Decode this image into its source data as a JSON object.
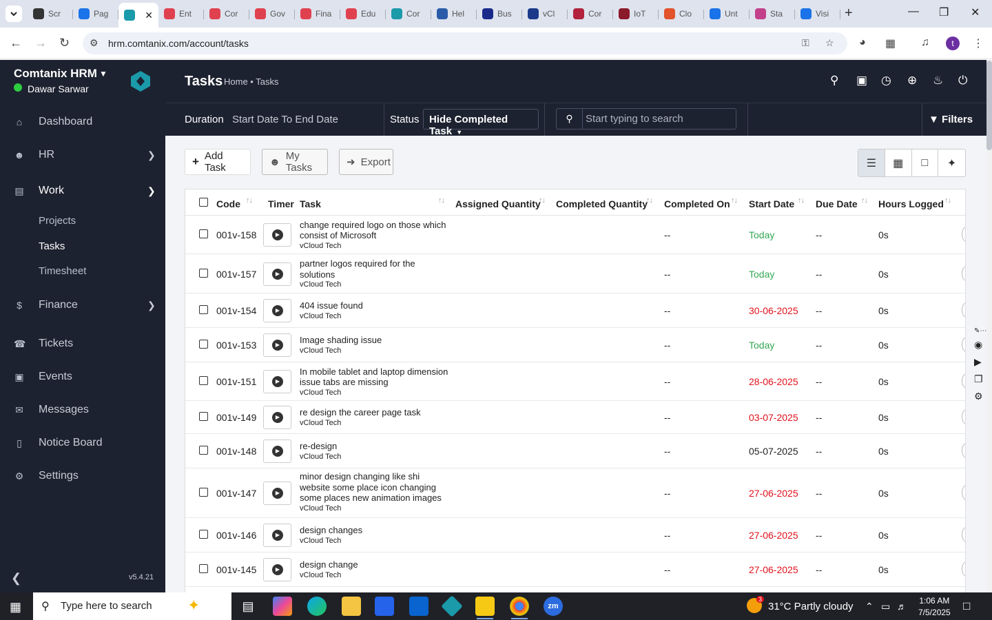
{
  "browser": {
    "tabs": [
      {
        "title": "Scr",
        "icon": "settings-tab-icon",
        "color": "#333333"
      },
      {
        "title": "Pag",
        "icon": "page-tab-icon",
        "color": "#1a73e8"
      },
      {
        "title": "",
        "icon": "comtanix-tab-icon",
        "color": "#1b9aaa",
        "active": true
      },
      {
        "title": "Ent",
        "icon": "gem-tab-icon",
        "color": "#e0414f"
      },
      {
        "title": "Cor",
        "icon": "gem-tab-icon",
        "color": "#e0414f"
      },
      {
        "title": "Gov",
        "icon": "gem-tab-icon",
        "color": "#e0414f"
      },
      {
        "title": "Fina",
        "icon": "gem-tab-icon",
        "color": "#e0414f"
      },
      {
        "title": "Edu",
        "icon": "gem-tab-icon",
        "color": "#e0414f"
      },
      {
        "title": "Cor",
        "icon": "comtanix-tab-icon",
        "color": "#1b9aaa"
      },
      {
        "title": "Hel",
        "icon": "scale-tab-icon",
        "color": "#2a5ba8"
      },
      {
        "title": "Bus",
        "icon": "x-tab-icon",
        "color": "#1b2a8a"
      },
      {
        "title": "vCl",
        "icon": "check-tab-icon",
        "color": "#1b3a8a"
      },
      {
        "title": "Cor",
        "icon": "swirl-tab-icon",
        "color": "#b2223c"
      },
      {
        "title": "IoT",
        "icon": "v-tab-icon",
        "color": "#8b1a2b"
      },
      {
        "title": "Clo",
        "icon": "slash-tab-icon",
        "color": "#e2522b"
      },
      {
        "title": "Unt",
        "icon": "doc-tab-icon",
        "color": "#1a73e8"
      },
      {
        "title": "Sta",
        "icon": "bolt-tab-icon",
        "color": "#c2408a"
      },
      {
        "title": "Visi",
        "icon": "wave-tab-icon",
        "color": "#1a73e8"
      }
    ],
    "url": "hrm.comtanix.com/account/tasks",
    "profile_initial": "t"
  },
  "sidebar": {
    "brand": "Comtanix HRM",
    "user": "Dawar Sarwar",
    "items": [
      {
        "label": "Dashboard",
        "icon": "home-icon"
      },
      {
        "label": "HR",
        "icon": "users-icon"
      },
      {
        "label": "Work",
        "icon": "briefcase-icon"
      },
      {
        "label": "Finance",
        "icon": "dollar-icon"
      },
      {
        "label": "Tickets",
        "icon": "headset-icon"
      },
      {
        "label": "Events",
        "icon": "calendar-icon"
      },
      {
        "label": "Messages",
        "icon": "message-icon"
      },
      {
        "label": "Notice Board",
        "icon": "clipboard-icon"
      },
      {
        "label": "Settings",
        "icon": "gear-icon"
      }
    ],
    "work_sub": [
      "Projects",
      "Tasks",
      "Timesheet"
    ],
    "version": "v5.4.21"
  },
  "topbar": {
    "title": "Tasks",
    "breadcrumb": "Home • Tasks"
  },
  "filters": {
    "duration_label": "Duration",
    "duration_value": "Start Date To End Date",
    "status_label": "Status",
    "status_value": "Hide Completed Task",
    "search_placeholder": "Start typing to search",
    "filters_label": "Filters"
  },
  "actions": {
    "add_task": "Add Task",
    "my_tasks": "My Tasks",
    "export": "Export"
  },
  "table": {
    "headers": [
      "Code",
      "Timer",
      "Task",
      "Assigned Quantity",
      "Completed Quantity",
      "Completed On",
      "Start Date",
      "Due Date",
      "Hours Logged"
    ],
    "rows": [
      {
        "code": "001v-158",
        "title": "change required logo on those which consist of Microsoft",
        "project": "vCloud Tech",
        "completed_on": "--",
        "start": "Today",
        "start_status": "green",
        "due": "--",
        "hours": "0s"
      },
      {
        "code": "001v-157",
        "title": "partner logos required for the solutions",
        "project": "vCloud Tech",
        "completed_on": "--",
        "start": "Today",
        "start_status": "green",
        "due": "--",
        "hours": "0s"
      },
      {
        "code": "001v-154",
        "title": "404 issue found",
        "project": "vCloud Tech",
        "completed_on": "--",
        "start": "30-06-2025",
        "start_status": "red",
        "due": "--",
        "hours": "0s"
      },
      {
        "code": "001v-153",
        "title": "Image shading issue",
        "project": "vCloud Tech",
        "completed_on": "--",
        "start": "Today",
        "start_status": "green",
        "due": "--",
        "hours": "0s"
      },
      {
        "code": "001v-151",
        "title": "In mobile tablet and laptop dimension issue tabs are missing",
        "project": "vCloud Tech",
        "completed_on": "--",
        "start": "28-06-2025",
        "start_status": "red",
        "due": "--",
        "hours": "0s"
      },
      {
        "code": "001v-149",
        "title": "re design the career page task",
        "project": "vCloud Tech",
        "completed_on": "--",
        "start": "03-07-2025",
        "start_status": "red",
        "due": "--",
        "hours": "0s"
      },
      {
        "code": "001v-148",
        "title": "re-design",
        "project": "vCloud Tech",
        "completed_on": "--",
        "start": "05-07-2025",
        "start_status": "normal",
        "due": "--",
        "hours": "0s"
      },
      {
        "code": "001v-147",
        "title": "minor design changing like shi website some place icon changing some places new animation images",
        "project": "vCloud Tech",
        "completed_on": "--",
        "start": "27-06-2025",
        "start_status": "red",
        "due": "--",
        "hours": "0s"
      },
      {
        "code": "001v-146",
        "title": "design changes",
        "project": "vCloud Tech",
        "completed_on": "--",
        "start": "27-06-2025",
        "start_status": "red",
        "due": "--",
        "hours": "0s"
      },
      {
        "code": "001v-145",
        "title": "design change",
        "project": "vCloud Tech",
        "completed_on": "--",
        "start": "27-06-2025",
        "start_status": "red",
        "due": "--",
        "hours": "0s"
      }
    ]
  },
  "taskbar": {
    "search_placeholder": "Type here to search",
    "weather": "31°C  Partly cloudy",
    "time": "1:06 AM",
    "date": "7/5/2025",
    "weather_badge": "3"
  },
  "colors": {
    "sidebar_bg": "#1d2230",
    "accent_green": "#34a853",
    "accent_red": "#e0111b",
    "brand_teal": "#1b9aaa"
  }
}
